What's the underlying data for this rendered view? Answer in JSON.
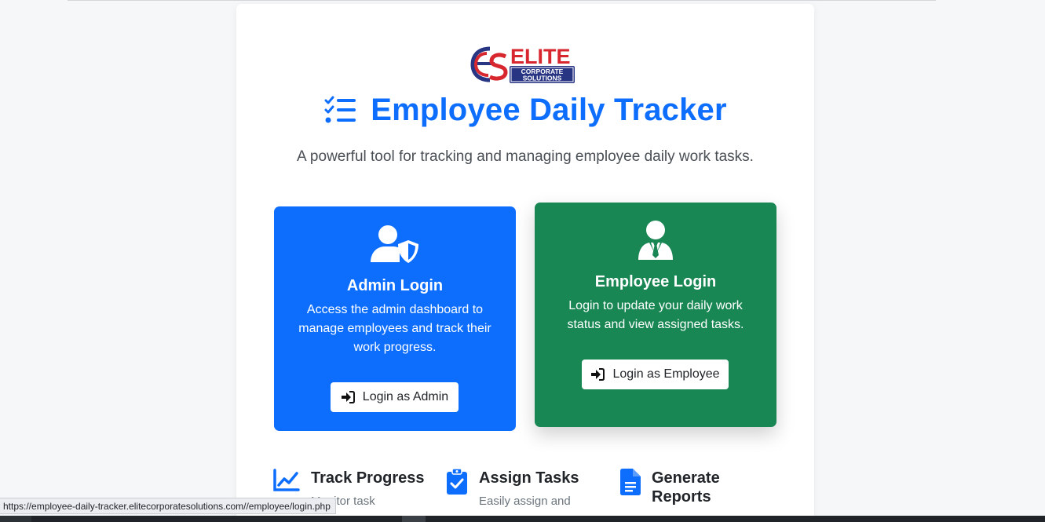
{
  "brand": {
    "logo_text": "ELITE",
    "logo_subtext_1": "CORPORATE",
    "logo_subtext_2": "SOLUTIONS",
    "logo_monogram": "ES"
  },
  "hero": {
    "title": "Employee Daily Tracker",
    "subtitle": "A powerful tool for tracking and managing employee daily work tasks."
  },
  "admin_card": {
    "icon": "user-shield-icon",
    "title": "Admin Login",
    "description": "Access the admin dashboard to manage employees and track their work progress.",
    "button_label": "Login as Admin",
    "color": "#0d6efd"
  },
  "employee_card": {
    "icon": "user-tie-icon",
    "title": "Employee Login",
    "description": "Login to update your daily work status and view assigned tasks.",
    "button_label": "Login as Employee",
    "color": "#198754"
  },
  "features": [
    {
      "icon": "chart-line-icon",
      "title": "Track Progress",
      "text": "Monitor task"
    },
    {
      "icon": "clipboard-check-icon",
      "title": "Assign Tasks",
      "text": "Easily assign and"
    },
    {
      "icon": "file-report-icon",
      "title": "Generate Reports",
      "text": ""
    }
  ],
  "status_bar": {
    "url": "https://employee-daily-tracker.elitecorporatesolutions.com//employee/login.php"
  },
  "colors": {
    "primary": "#0d6efd",
    "success": "#198754",
    "logo_red": "#d7262e",
    "logo_navy": "#283583"
  }
}
